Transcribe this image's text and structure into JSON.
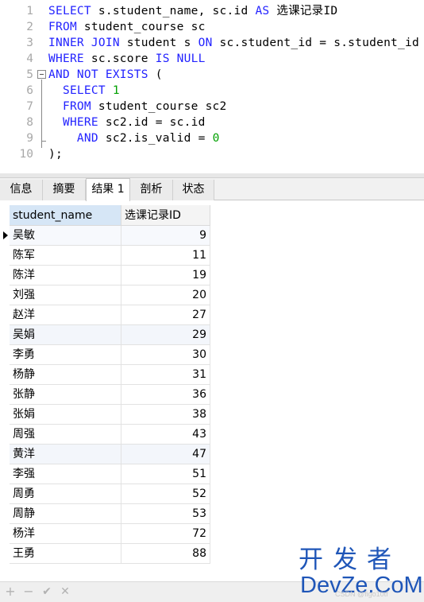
{
  "editor": {
    "lines": [
      {
        "n": "1",
        "tokens": [
          {
            "t": "SELECT",
            "c": "kw"
          },
          {
            "t": " s.student_name, sc.id "
          },
          {
            "t": "AS",
            "c": "kw"
          },
          {
            "t": " 选课记录ID"
          }
        ]
      },
      {
        "n": "2",
        "tokens": [
          {
            "t": "FROM",
            "c": "kw"
          },
          {
            "t": " student_course sc"
          }
        ]
      },
      {
        "n": "3",
        "tokens": [
          {
            "t": "INNER JOIN",
            "c": "kw"
          },
          {
            "t": " student s "
          },
          {
            "t": "ON",
            "c": "kw"
          },
          {
            "t": " sc.student_id = s.student_id"
          }
        ]
      },
      {
        "n": "4",
        "tokens": [
          {
            "t": "WHERE",
            "c": "kw"
          },
          {
            "t": " sc.score "
          },
          {
            "t": "IS NULL",
            "c": "kw"
          }
        ]
      },
      {
        "n": "5",
        "tokens": [
          {
            "t": "AND NOT EXISTS",
            "c": "kw"
          },
          {
            "t": " ("
          }
        ]
      },
      {
        "n": "6",
        "tokens": [
          {
            "t": "  "
          },
          {
            "t": "SELECT",
            "c": "kw"
          },
          {
            "t": " "
          },
          {
            "t": "1",
            "c": "num"
          }
        ]
      },
      {
        "n": "7",
        "tokens": [
          {
            "t": "  "
          },
          {
            "t": "FROM",
            "c": "kw"
          },
          {
            "t": " student_course sc2"
          }
        ]
      },
      {
        "n": "8",
        "tokens": [
          {
            "t": "  "
          },
          {
            "t": "WHERE",
            "c": "kw"
          },
          {
            "t": " sc2.id = sc.id"
          }
        ]
      },
      {
        "n": "9",
        "tokens": [
          {
            "t": "    "
          },
          {
            "t": "AND",
            "c": "kw"
          },
          {
            "t": " sc2.is_valid = "
          },
          {
            "t": "0",
            "c": "num"
          }
        ]
      },
      {
        "n": "10",
        "tokens": [
          {
            "t": ");"
          }
        ]
      }
    ]
  },
  "tabs": [
    {
      "label": "信息",
      "name": "tab-info",
      "active": false
    },
    {
      "label": "摘要",
      "name": "tab-summary",
      "active": false
    },
    {
      "label": "结果 1",
      "name": "tab-result-1",
      "active": true
    },
    {
      "label": "剖析",
      "name": "tab-profile",
      "active": false
    },
    {
      "label": "状态",
      "name": "tab-status",
      "active": false
    }
  ],
  "grid": {
    "columns": [
      "student_name",
      "选课记录ID"
    ],
    "rows": [
      [
        "吴敏",
        "9"
      ],
      [
        "陈军",
        "11"
      ],
      [
        "陈洋",
        "19"
      ],
      [
        "刘强",
        "20"
      ],
      [
        "赵洋",
        "27"
      ],
      [
        "吴娟",
        "29"
      ],
      [
        "李勇",
        "30"
      ],
      [
        "杨静",
        "31"
      ],
      [
        "张静",
        "36"
      ],
      [
        "张娟",
        "38"
      ],
      [
        "周强",
        "43"
      ],
      [
        "黄洋",
        "47"
      ],
      [
        "李强",
        "51"
      ],
      [
        "周勇",
        "52"
      ],
      [
        "周静",
        "53"
      ],
      [
        "杨洋",
        "72"
      ],
      [
        "王勇",
        "88"
      ]
    ]
  },
  "toolbar": {
    "add": "+",
    "remove": "−",
    "apply": "✔",
    "discard": "✕"
  },
  "watermark": {
    "top": "开发者",
    "bottom": "DevZe.CoM",
    "small": "CSDN @figo10tf"
  },
  "colors": {
    "keyword": "#2222ff",
    "number": "#00a000",
    "watermark": "#1f56b8"
  }
}
